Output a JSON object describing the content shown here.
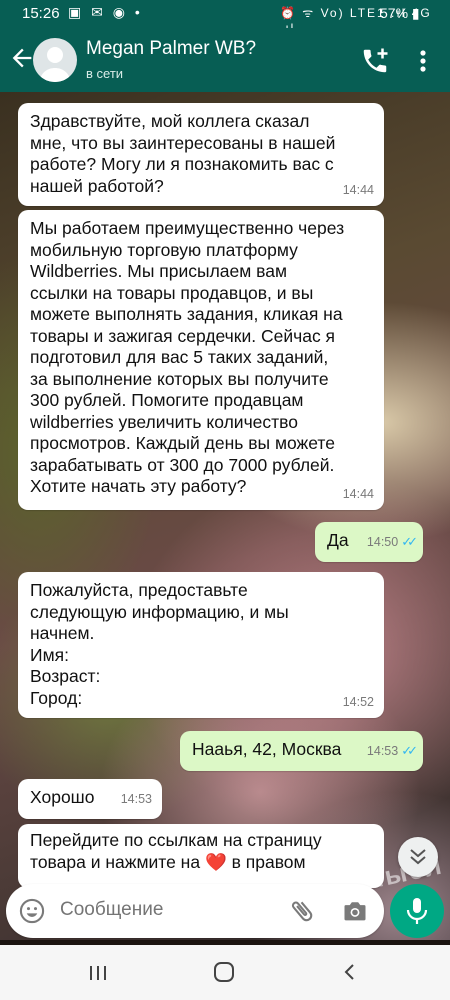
{
  "status_bar": {
    "time": "15:26",
    "left_icons": "▣ ✉ ◉ •",
    "right_icons": "⏰ ᯤ Vo) LTE1 .ıl 4G .ıl",
    "battery": "57%"
  },
  "header": {
    "contact_name": "Megan Palmer WB?",
    "presence": "в сети"
  },
  "messages": [
    {
      "direction": "in",
      "text": "Здравствуйте, мой коллега сказал\nмне, что вы заинтересованы в нашей\nработе? Могу ли я познакомить вас с\nнашей работой?",
      "time": "14:44"
    },
    {
      "direction": "in",
      "text": "Мы работаем преимущественно через\nмобильную торговую платформу\nWildberries. Мы присылаем вам\nссылки на товары продавцов, и вы\nможете выполнять задания, кликая на\nтовары и зажигая сердечки. Сейчас я\nподготовил для вас 5 таких заданий,\nза выполнение которых вы получите\n300 рублей. Помогите продавцам\nwildberries увеличить количество\nпросмотров. Каждый день вы можете\nзарабатывать от 300 до 7000 рублей.\nХотите начать эту работу?",
      "time": "14:44"
    },
    {
      "direction": "out",
      "text": "Да",
      "time": "14:50",
      "ticks": "✓✓"
    },
    {
      "direction": "in",
      "text": "Пожалуйста, предоставьте\nследующую информацию, и мы\nначнем.\nИмя:\nВозраст:\nГород:",
      "time": "14:52"
    },
    {
      "direction": "out",
      "text": "Нааья, 42, Москва",
      "time": "14:53",
      "ticks": "✓✓"
    },
    {
      "direction": "in",
      "text": "Хорошо",
      "time": "14:53"
    },
    {
      "direction": "in",
      "text_before": "Перейдите по ссылкам на страницу\nтовара и нажмите на ",
      "emoji": "❤️",
      "text_after": " в правом"
    }
  ],
  "wallpaper_text": "их мысл",
  "composer": {
    "placeholder": "Сообщение"
  },
  "colors": {
    "header": "#075e54",
    "outgoing_bubble": "#dcf8c6",
    "incoming_bubble": "#ffffff",
    "read_ticks": "#34b7f1",
    "mic_button": "#00a884"
  },
  "icons": [
    "back-arrow-icon",
    "add-call-icon",
    "more-vert-icon",
    "emoji-icon",
    "attach-icon",
    "camera-icon",
    "mic-icon",
    "scroll-down-icon",
    "recents-icon",
    "home-icon",
    "back-nav-icon"
  ]
}
